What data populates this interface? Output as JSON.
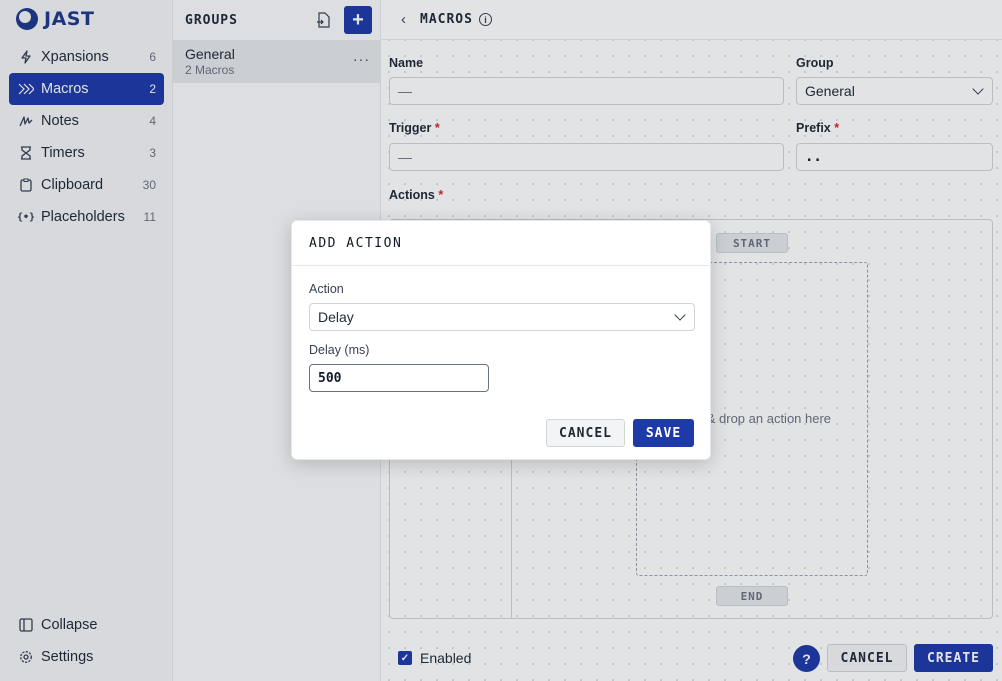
{
  "app": {
    "logo_text": "JAST"
  },
  "sidebar": {
    "items": [
      {
        "label": "Xpansions",
        "count": "6",
        "icon": "bolt-icon"
      },
      {
        "label": "Macros",
        "count": "2",
        "icon": "chevrons-right-icon",
        "active": true
      },
      {
        "label": "Notes",
        "count": "4",
        "icon": "scribble-icon"
      },
      {
        "label": "Timers",
        "count": "3",
        "icon": "hourglass-icon"
      },
      {
        "label": "Clipboard",
        "count": "30",
        "icon": "clipboard-icon"
      },
      {
        "label": "Placeholders",
        "count": "11",
        "icon": "braces-icon"
      }
    ],
    "bottom": [
      {
        "label": "Collapse",
        "icon": "collapse-icon"
      },
      {
        "label": "Settings",
        "icon": "gear-icon"
      }
    ]
  },
  "groups": {
    "title": "GROUPS",
    "items": [
      {
        "name": "General",
        "sub": "2 Macros",
        "more": "···"
      }
    ]
  },
  "main": {
    "title": "MACROS",
    "fields": {
      "name_label": "Name",
      "name_value": "—",
      "group_label": "Group",
      "group_value": "General",
      "trigger_label": "Trigger",
      "trigger_value": "—",
      "prefix_label": "Prefix",
      "prefix_value": "..",
      "actions_label": "Actions",
      "required_mark": "*"
    },
    "actions": {
      "start": "START",
      "end": "END",
      "dropzone_text": "Drag & drop an action here"
    },
    "footer": {
      "enabled_label": "Enabled",
      "help": "?",
      "cancel": "CANCEL",
      "create": "CREATE"
    }
  },
  "modal": {
    "title": "ADD ACTION",
    "action_label": "Action",
    "action_value": "Delay",
    "delay_label": "Delay (ms)",
    "delay_value": "500",
    "cancel": "CANCEL",
    "save": "SAVE"
  },
  "colors": {
    "accent": "#1e3aa8",
    "brand": "#1e3a8a",
    "required": "#dc2626"
  }
}
